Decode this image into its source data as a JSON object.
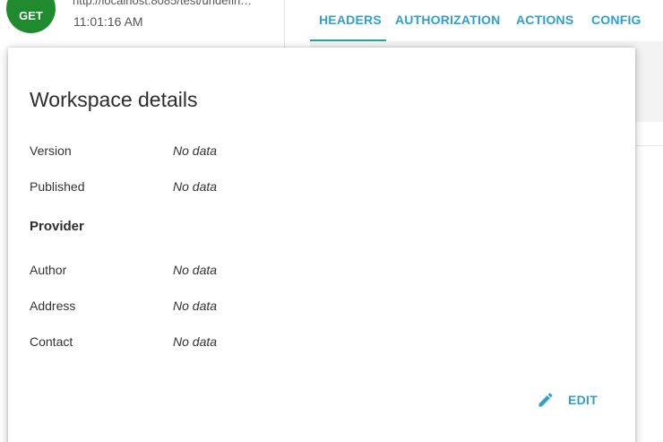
{
  "request": {
    "method": "GET",
    "url": "http://localhost:8085/test/undefin…",
    "time": "11:01:16 AM"
  },
  "tabs": [
    {
      "label": "HEADERS",
      "active": true
    },
    {
      "label": "AUTHORIZATION",
      "active": false
    },
    {
      "label": "ACTIONS",
      "active": false
    },
    {
      "label": "CONFIG",
      "active": false
    }
  ],
  "dialog": {
    "title": "Workspace details",
    "fields": [
      {
        "label": "Version",
        "value": "No data"
      },
      {
        "label": "Published",
        "value": "No data"
      }
    ],
    "provider": {
      "heading": "Provider",
      "fields": [
        {
          "label": "Author",
          "value": "No data"
        },
        {
          "label": "Address",
          "value": "No data"
        },
        {
          "label": "Contact",
          "value": "No data"
        }
      ]
    },
    "edit_label": "EDIT"
  },
  "colors": {
    "method_badge": "#1f8a2e",
    "accent": "#2f9fd1",
    "active_tab_indicator": "#2aa39a"
  },
  "icons": {
    "edit": "pencil-icon"
  }
}
